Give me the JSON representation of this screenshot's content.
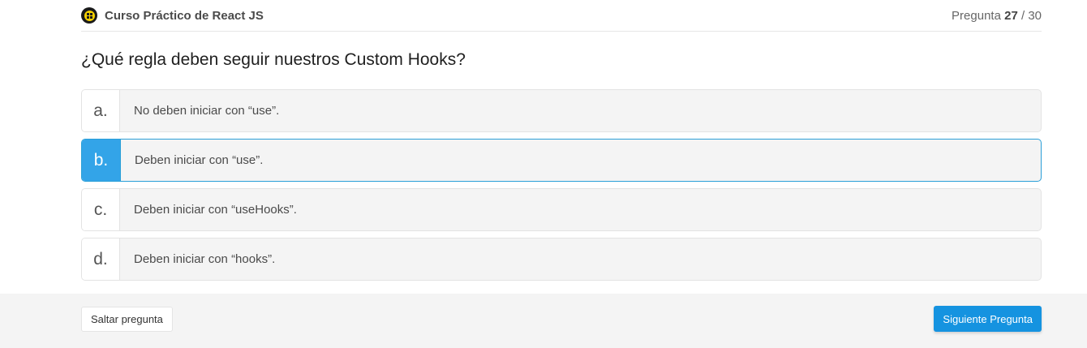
{
  "header": {
    "course_title": "Curso Práctico de React JS",
    "progress_label": "Pregunta",
    "current_question": "27",
    "progress_separator": "/",
    "total_questions": "30"
  },
  "question": {
    "text": "¿Qué regla deben seguir nuestros Custom Hooks?"
  },
  "options": [
    {
      "letter": "a.",
      "text": "No deben iniciar con “use”.",
      "selected": false
    },
    {
      "letter": "b.",
      "text": "Deben iniciar con “use”.",
      "selected": true
    },
    {
      "letter": "c.",
      "text": "Deben iniciar con “useHooks”.",
      "selected": false
    },
    {
      "letter": "d.",
      "text": "Deben iniciar con “hooks”.",
      "selected": false
    }
  ],
  "footer": {
    "skip_label": "Saltar pregunta",
    "next_label": "Siguiente Pregunta"
  },
  "colors": {
    "accent": "#1593e0",
    "selected_letter_bg": "#33a4e8",
    "logo_yellow": "#f5d000"
  },
  "icons": {
    "logo": "react-course-logo-icon"
  }
}
